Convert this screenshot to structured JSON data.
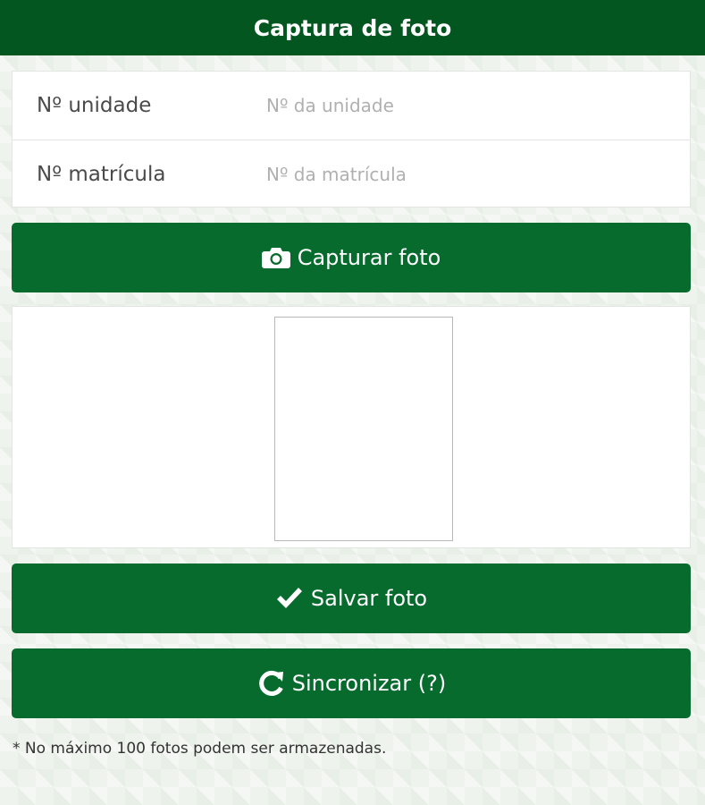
{
  "header": {
    "title": "Captura de foto"
  },
  "form": {
    "unit": {
      "label": "Nº unidade",
      "placeholder": "Nº da unidade",
      "value": ""
    },
    "registration": {
      "label": "Nº matrícula",
      "placeholder": "Nº da matrícula",
      "value": ""
    }
  },
  "buttons": {
    "capture": {
      "label": "Capturar foto",
      "icon": "camera-icon"
    },
    "save": {
      "label": "Salvar foto",
      "icon": "check-icon"
    },
    "sync": {
      "label": "Sincronizar (?)",
      "icon": "refresh-icon"
    }
  },
  "footnote": "* No máximo 100 fotos podem ser armazenadas.",
  "colors": {
    "header_bg": "#03561f",
    "button_bg": "#066b2c",
    "page_bg": "#eef3ed"
  }
}
